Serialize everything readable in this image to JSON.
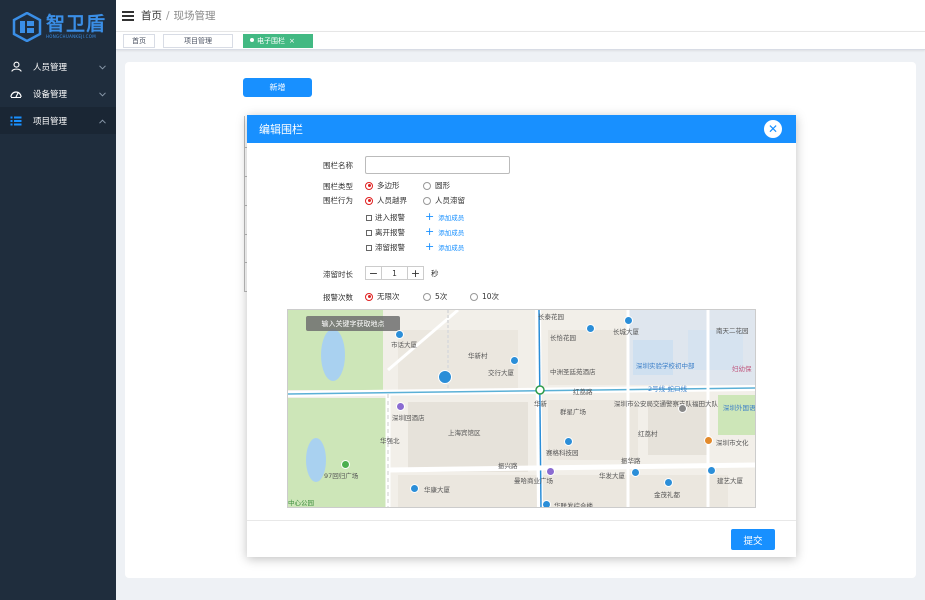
{
  "app": {
    "logo_title": "智卫盾",
    "logo_sub": "HONGCHUANKEJI.COM",
    "brand_color": "#1890ff"
  },
  "sidebar": {
    "items": [
      {
        "label": "人员管理",
        "icon": "user-icon",
        "chevron": "down"
      },
      {
        "label": "设备管理",
        "icon": "dashboard-icon",
        "chevron": "down"
      },
      {
        "label": "项目管理",
        "icon": "list-icon",
        "chevron": "up"
      }
    ]
  },
  "header": {
    "breadcrumb_home": "首页",
    "breadcrumb_sep": "/",
    "breadcrumb_current": "现场管理"
  },
  "tags": [
    {
      "label": "首页"
    },
    {
      "label": "项目管理"
    },
    {
      "label": "电子围栏",
      "close": "×",
      "active": true
    }
  ],
  "page": {
    "add_button": "新增"
  },
  "dialog": {
    "title": "编辑围栏",
    "close": "✕",
    "fence_name_label": "围栏名称",
    "fence_name_value": "",
    "fence_type_label": "围栏类型",
    "fence_type_options": [
      "多边形",
      "圆形"
    ],
    "fence_type_selected": "多边形",
    "fence_behavior_label": "围栏行为",
    "fence_behavior_options": [
      "人员越界",
      "人员滞留"
    ],
    "fence_behavior_selected": "人员越界",
    "alarms": [
      {
        "label": "进入报警",
        "add": "添加成员"
      },
      {
        "label": "离开报警",
        "add": "添加成员"
      },
      {
        "label": "滞留报警",
        "add": "添加成员"
      }
    ],
    "stay_label": "滞留时长",
    "stay_minus": "−",
    "stay_value": "1",
    "stay_plus": "+",
    "stay_unit": "秒",
    "alarm_count_label": "报警次数",
    "alarm_count_options": [
      "无限次",
      "5次",
      "10次"
    ],
    "alarm_count_selected": "无限次",
    "map_search_placeholder": "输入关键字获取地点",
    "submit": "提交"
  },
  "map_labels": {
    "l1": "长泰花园",
    "l2": "长恰花园",
    "l3": "长城大厦",
    "l4": "南天二花园",
    "l5": "市话大厦",
    "l6": "华新村",
    "l7": "交行大厦",
    "l8": "中洲圣廷苑酒店",
    "l9": "深圳实验学校初中部",
    "l10": "妇幼保",
    "l11": "华新",
    "l12": "红荔路",
    "l13": "2号线-蛇口线",
    "l14": "深圳市公安局交通警察支队福田大队",
    "l15": "群星广场",
    "l16": "深圳外国语学校初中部",
    "l17": "深圳回酒店",
    "l18": "上海宾馆区",
    "l19": "红荔村",
    "l20": "赛格科技园",
    "l21": "深圳市文化",
    "l22": "华强北",
    "l23": "振兴路",
    "l24": "振华路",
    "l25": "97回归广场",
    "l26": "曼哈商业广场",
    "l27": "华发大厦",
    "l28": "建艺大厦",
    "l29": "华康大厦",
    "l30": "金茂礼都",
    "l31": "中心公园",
    "l32": "华联发综合楼"
  }
}
